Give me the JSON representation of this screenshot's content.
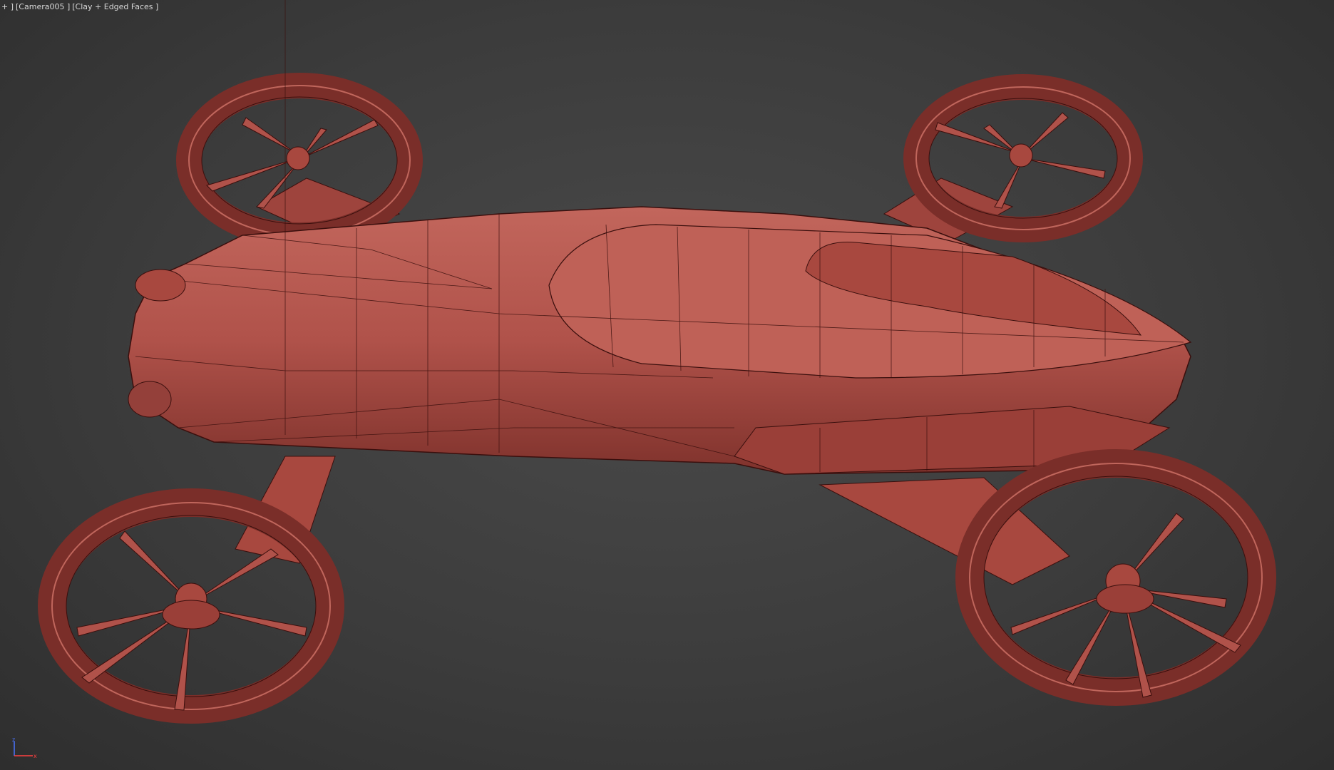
{
  "viewport": {
    "menu_label": "+ ]",
    "camera_label": "[Camera005 ]",
    "shading_label": "[Clay + Edged Faces ]"
  },
  "colors": {
    "background": "#3c3c3c",
    "clay": "#b0524a",
    "clay_light": "#c86a60",
    "clay_dark": "#7a2e29",
    "wire": "#3a0f0d",
    "label": "#d8d8d8"
  },
  "gizmo": {
    "axis_z": "z",
    "axis_x": "x"
  }
}
